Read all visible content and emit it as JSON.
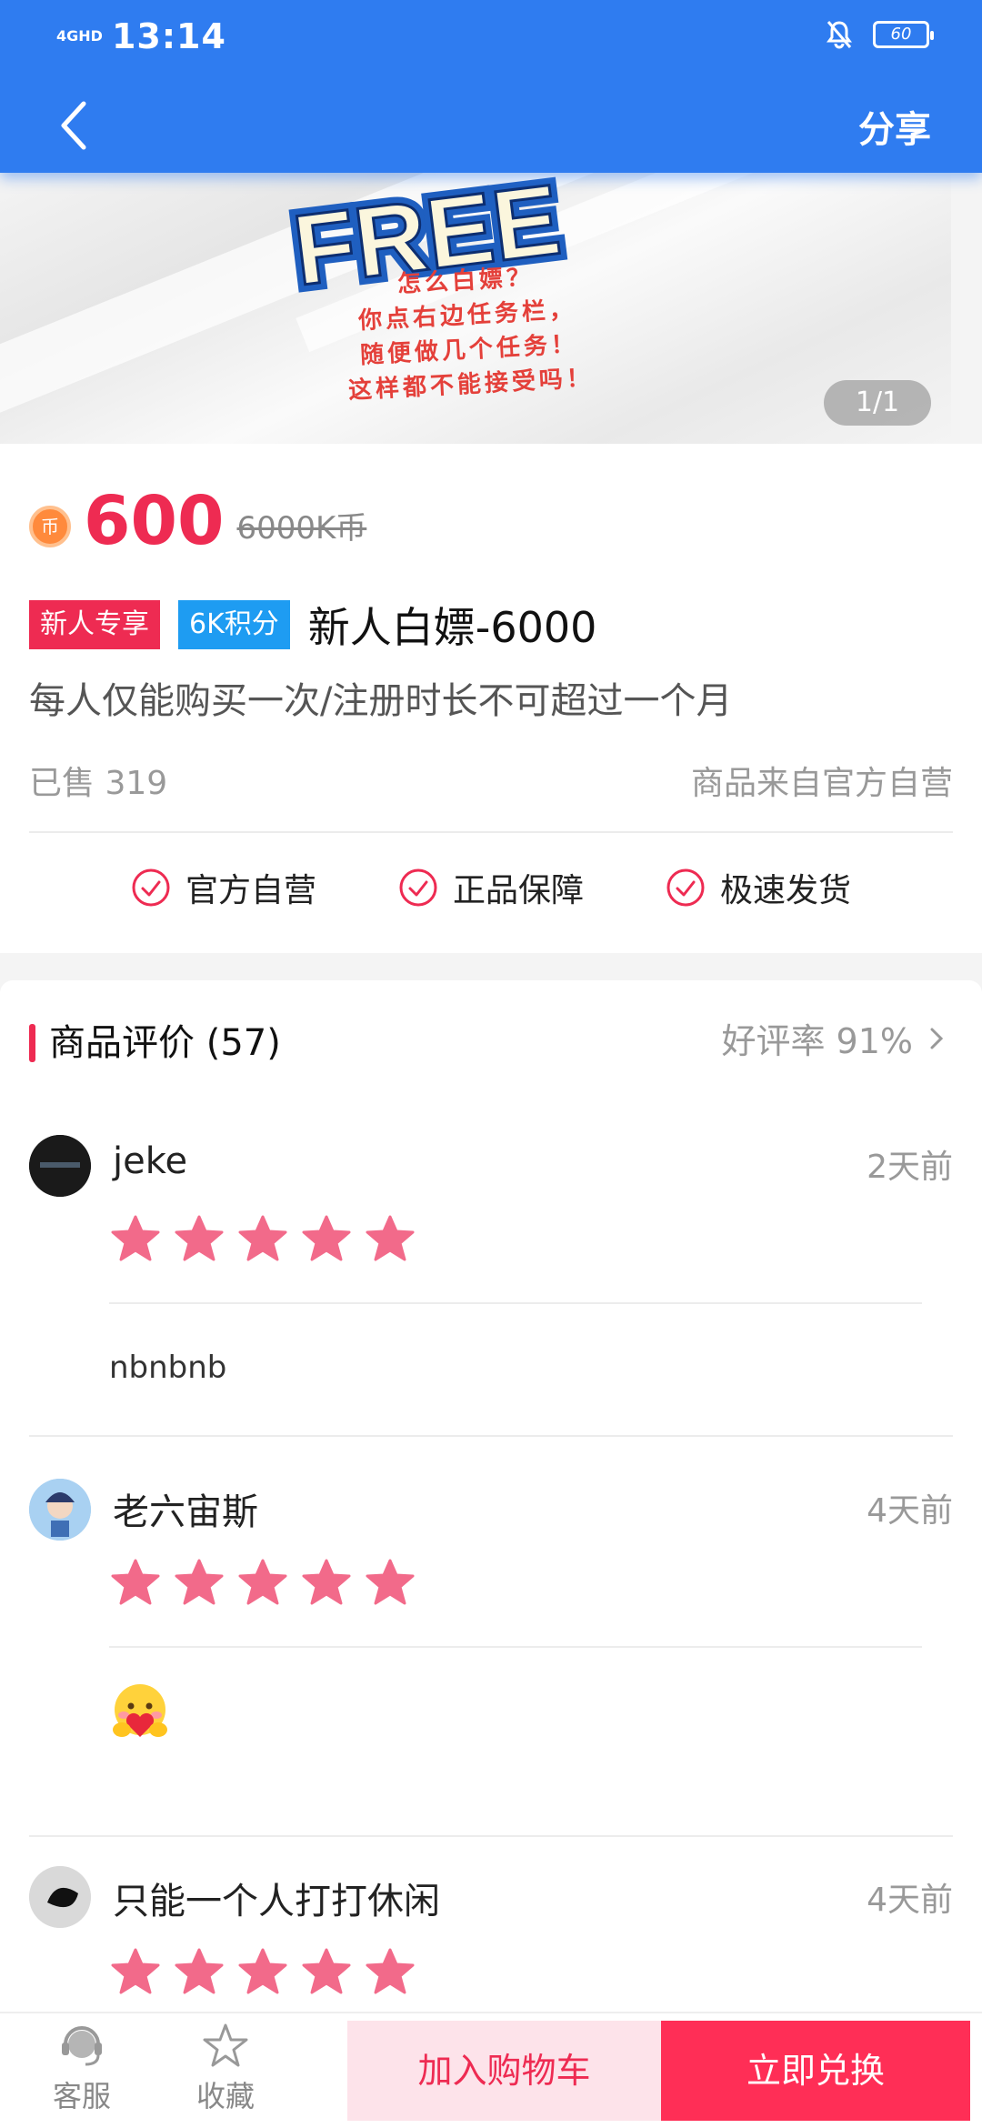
{
  "status": {
    "network": "4GHD",
    "time": "13:14",
    "battery": "60"
  },
  "header": {
    "share_label": "分享"
  },
  "banner": {
    "logo_text": "FREE",
    "lines": [
      "怎么白嫖？",
      "你点右边任务栏，",
      "随便做几个任务！",
      "这样都不能接受吗！"
    ],
    "pager": "1/1"
  },
  "product": {
    "price": "600",
    "original_price": "6000K币",
    "coin_symbol": "币",
    "tags": [
      "新人专享",
      "6K积分"
    ],
    "title": "新人白嫖-6000",
    "description": "每人仅能购买一次/注册时长不可超过一个月",
    "sold": "已售 319",
    "source": "商品来自官方自营",
    "guarantees": [
      "官方自营",
      "正品保障",
      "极速发货"
    ]
  },
  "reviews": {
    "title": "商品评价 (57)",
    "positive_rate": "好评率 91%",
    "items": [
      {
        "user": "jeke",
        "time": "2天前",
        "stars": 5,
        "text": "nbnbnb"
      },
      {
        "user": "老六宙斯",
        "time": "4天前",
        "stars": 5,
        "text": "🤗"
      },
      {
        "user": "只能一个人打打休闲",
        "time": "4天前",
        "stars": 5,
        "text": ""
      }
    ]
  },
  "bottom": {
    "service_label": "客服",
    "favorite_label": "收藏",
    "cart_button": "加入购物车",
    "buy_button": "立即兑换"
  },
  "colors": {
    "header": "#2f7cf0",
    "accent": "#ee2b52",
    "star": "#f26a8a"
  }
}
